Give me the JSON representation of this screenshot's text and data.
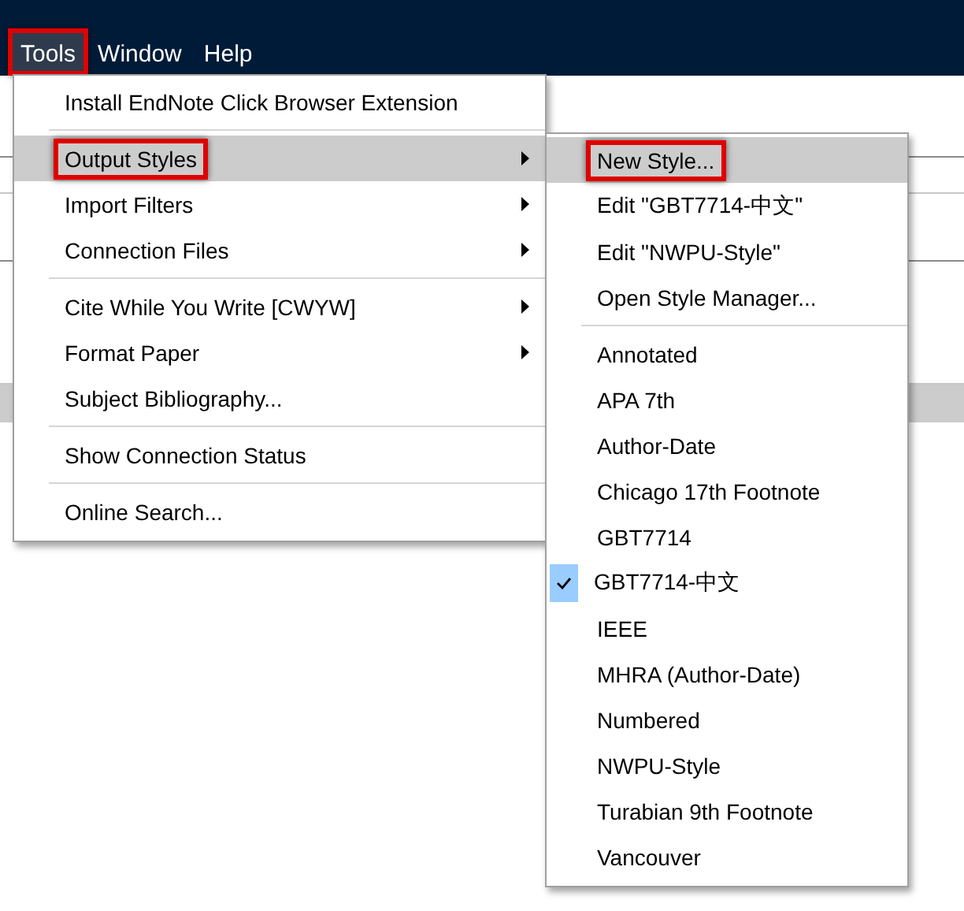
{
  "menu_bar": [
    {
      "label": "Tools",
      "selected": true,
      "annotated": true
    },
    {
      "label": "Window",
      "selected": false,
      "annotated": false
    },
    {
      "label": "Help",
      "selected": false,
      "annotated": false
    }
  ],
  "tools_menu": {
    "items": [
      {
        "kind": "item",
        "label": "Install EndNote Click Browser Extension",
        "has_submenu": false,
        "selected": false,
        "annotated": false
      },
      {
        "kind": "separator"
      },
      {
        "kind": "item",
        "label": "Output Styles",
        "has_submenu": true,
        "selected": true,
        "annotated": true
      },
      {
        "kind": "item",
        "label": "Import Filters",
        "has_submenu": true,
        "selected": false,
        "annotated": false
      },
      {
        "kind": "item",
        "label": "Connection Files",
        "has_submenu": true,
        "selected": false,
        "annotated": false
      },
      {
        "kind": "separator"
      },
      {
        "kind": "item",
        "label": "Cite While You Write [CWYW]",
        "has_submenu": true,
        "selected": false,
        "annotated": false
      },
      {
        "kind": "item",
        "label": "Format Paper",
        "has_submenu": true,
        "selected": false,
        "annotated": false
      },
      {
        "kind": "item",
        "label": "Subject Bibliography...",
        "has_submenu": false,
        "selected": false,
        "annotated": false
      },
      {
        "kind": "separator"
      },
      {
        "kind": "item",
        "label": "Show Connection Status",
        "has_submenu": false,
        "selected": false,
        "annotated": false
      },
      {
        "kind": "separator"
      },
      {
        "kind": "item",
        "label": "Online Search...",
        "has_submenu": false,
        "selected": false,
        "annotated": false
      }
    ]
  },
  "output_styles_menu": {
    "items": [
      {
        "kind": "item",
        "label": "New Style...",
        "selected": true,
        "annotated": true,
        "checked": false
      },
      {
        "kind": "item",
        "label": "Edit \"GBT7714-中文\"",
        "selected": false,
        "annotated": false,
        "checked": false
      },
      {
        "kind": "item",
        "label": "Edit \"NWPU-Style\"",
        "selected": false,
        "annotated": false,
        "checked": false
      },
      {
        "kind": "item",
        "label": "Open Style Manager...",
        "selected": false,
        "annotated": false,
        "checked": false
      },
      {
        "kind": "separator"
      },
      {
        "kind": "item",
        "label": "Annotated",
        "selected": false,
        "annotated": false,
        "checked": false
      },
      {
        "kind": "item",
        "label": "APA 7th",
        "selected": false,
        "annotated": false,
        "checked": false
      },
      {
        "kind": "item",
        "label": "Author-Date",
        "selected": false,
        "annotated": false,
        "checked": false
      },
      {
        "kind": "item",
        "label": "Chicago 17th Footnote",
        "selected": false,
        "annotated": false,
        "checked": false
      },
      {
        "kind": "item",
        "label": "GBT7714",
        "selected": false,
        "annotated": false,
        "checked": false
      },
      {
        "kind": "item",
        "label": "GBT7714-中文",
        "selected": false,
        "annotated": false,
        "checked": true
      },
      {
        "kind": "item",
        "label": "IEEE",
        "selected": false,
        "annotated": false,
        "checked": false
      },
      {
        "kind": "item",
        "label": "MHRA (Author-Date)",
        "selected": false,
        "annotated": false,
        "checked": false
      },
      {
        "kind": "item",
        "label": "Numbered",
        "selected": false,
        "annotated": false,
        "checked": false
      },
      {
        "kind": "item",
        "label": "NWPU-Style",
        "selected": false,
        "annotated": false,
        "checked": false
      },
      {
        "kind": "item",
        "label": "Turabian 9th Footnote",
        "selected": false,
        "annotated": false,
        "checked": false
      },
      {
        "kind": "item",
        "label": "Vancouver",
        "selected": false,
        "annotated": false,
        "checked": false
      }
    ]
  }
}
